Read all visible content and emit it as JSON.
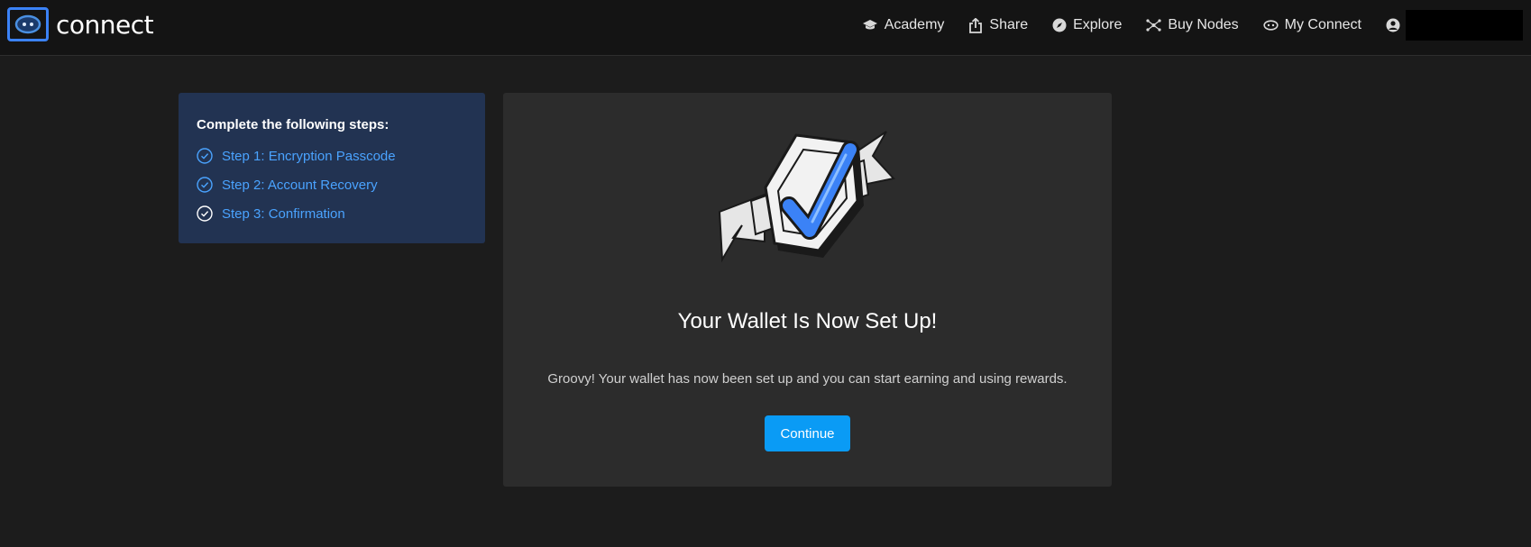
{
  "header": {
    "logo_text": "connect",
    "nav": [
      {
        "label": "Academy",
        "icon": "graduation-cap-icon"
      },
      {
        "label": "Share",
        "icon": "share-icon"
      },
      {
        "label": "Explore",
        "icon": "compass-icon"
      },
      {
        "label": "Buy Nodes",
        "icon": "nodes-icon"
      },
      {
        "label": "My Connect",
        "icon": "eye-icon"
      }
    ],
    "user_icon": "user-circle-icon"
  },
  "steps": {
    "title": "Complete the following steps:",
    "items": [
      {
        "label": "Step 1: Encryption Passcode",
        "icon": "check-circle-icon"
      },
      {
        "label": "Step 2: Account Recovery",
        "icon": "check-circle-icon"
      },
      {
        "label": "Step 3: Confirmation",
        "icon": "check-circle-icon"
      }
    ]
  },
  "card": {
    "title": "Your Wallet Is Now Set Up!",
    "message": "Groovy! Your wallet has now been set up and you can start earning and using rewards.",
    "button_label": "Continue"
  },
  "colors": {
    "accent": "#0a9bf5",
    "link": "#4aa3ff",
    "steps_bg": "#223352",
    "card_bg": "#2c2c2c",
    "page_bg": "#1c1c1c"
  }
}
